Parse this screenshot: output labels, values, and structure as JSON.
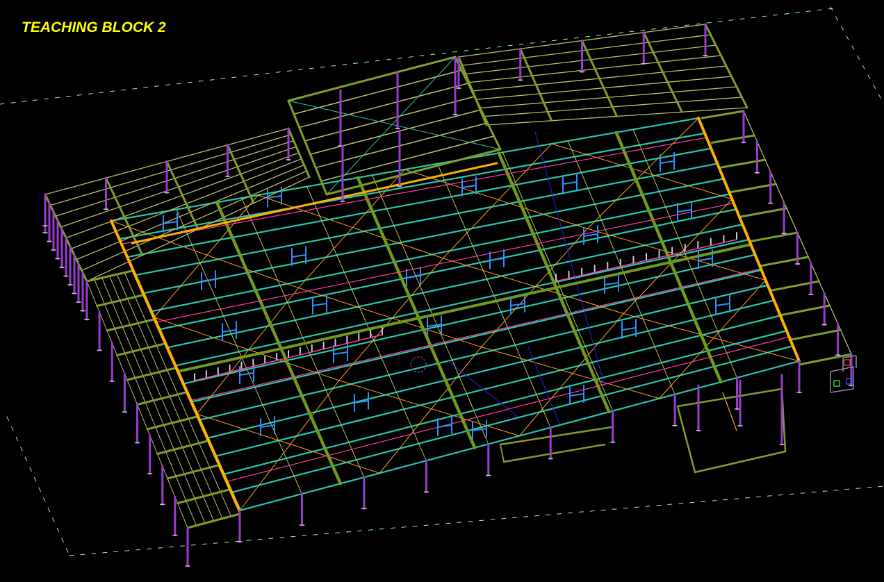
{
  "title": "TEACHING BLOCK 2",
  "colors": {
    "background": "#000000",
    "title": "#ffff00",
    "frame_member": "#7ea02a",
    "main_girder": "#6f9b1c",
    "purlin": "#b9c26a",
    "beam_cyan": "#27c7b0",
    "column": "#9a3ccf",
    "column_dark": "#5b2fc4",
    "bracing_orange": "#ffa51f",
    "edge_orange": "#ffb000",
    "edge_magenta": "#ff3fa0",
    "window_blue": "#2f8fff",
    "grid_line": "#9cff9c",
    "truss_white": "#cfc8d8",
    "dark_blue": "#2020c0"
  },
  "views": {
    "model": "3d-wireframe-view",
    "navigator": "view-cube-icon"
  }
}
